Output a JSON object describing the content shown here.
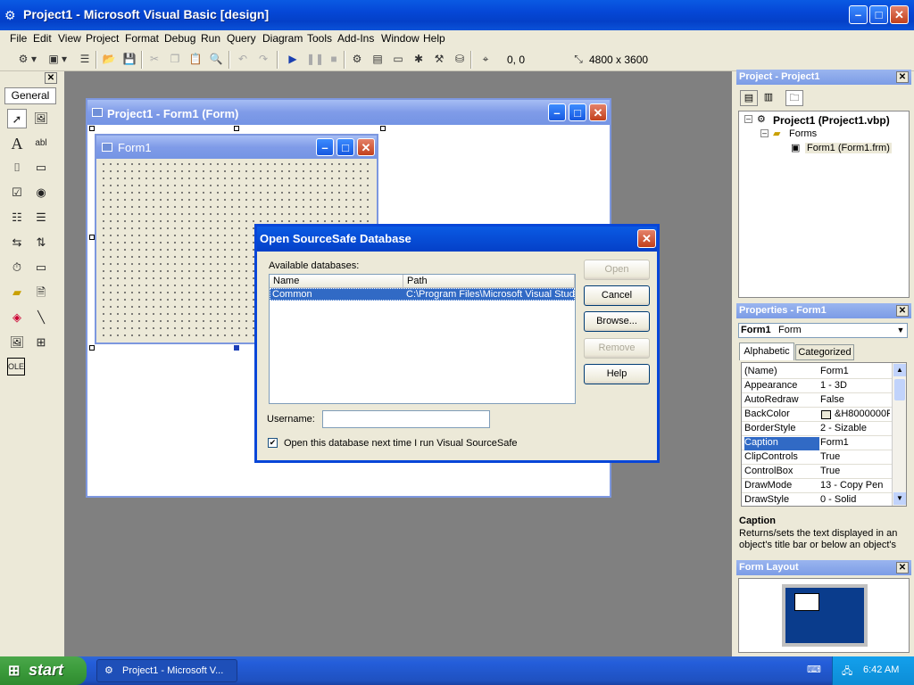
{
  "app": {
    "title": "Project1 - Microsoft Visual Basic [design]"
  },
  "menu": [
    "File",
    "Edit",
    "View",
    "Project",
    "Format",
    "Debug",
    "Run",
    "Query",
    "Diagram",
    "Tools",
    "Add-Ins",
    "Window",
    "Help"
  ],
  "toolbar": {
    "position": "0, 0",
    "size": "4800 x 3600"
  },
  "toolbox": {
    "tab": "General"
  },
  "form_window": {
    "title": "Project1 - Form1 (Form)"
  },
  "form1": {
    "title": "Form1"
  },
  "dialog": {
    "title": "Open SourceSafe Database",
    "available_label": "Available databases:",
    "columns": [
      "Name",
      "Path"
    ],
    "rows": [
      {
        "name": "Common",
        "path": "C:\\Program Files\\Microsoft Visual Studio"
      }
    ],
    "buttons": {
      "open": "Open",
      "cancel": "Cancel",
      "browse": "Browse...",
      "remove": "Remove",
      "help": "Help"
    },
    "username_label": "Username:",
    "username_value": "",
    "checkbox_label": "Open this database next time I run Visual SourceSafe"
  },
  "project_panel": {
    "title": "Project - Project1",
    "root": "Project1 (Project1.vbp)",
    "folder": "Forms",
    "item": "Form1 (Form1.frm)"
  },
  "properties_panel": {
    "title": "Properties - Form1",
    "object_name": "Form1",
    "object_type": "Form",
    "tabs": [
      "Alphabetic",
      "Categorized"
    ],
    "rows": [
      {
        "name": "(Name)",
        "value": "Form1"
      },
      {
        "name": "Appearance",
        "value": "1 - 3D"
      },
      {
        "name": "AutoRedraw",
        "value": "False"
      },
      {
        "name": "BackColor",
        "value": "&H8000000F"
      },
      {
        "name": "BorderStyle",
        "value": "2 - Sizable"
      },
      {
        "name": "Caption",
        "value": "Form1"
      },
      {
        "name": "ClipControls",
        "value": "True"
      },
      {
        "name": "ControlBox",
        "value": "True"
      },
      {
        "name": "DrawMode",
        "value": "13 - Copy Pen"
      },
      {
        "name": "DrawStyle",
        "value": "0 - Solid"
      }
    ],
    "desc_title": "Caption",
    "desc_text": "Returns/sets the text displayed in an object's title bar or below an object's"
  },
  "layout_panel": {
    "title": "Form Layout"
  },
  "taskbar": {
    "start": "start",
    "task": "Project1 - Microsoft V...",
    "clock": "6:42 AM"
  },
  "colors": {
    "xp_blue": "#0a5ae3",
    "mdi_title": "#7f9be8",
    "selection": "#316ac5",
    "workspace": "#808080"
  }
}
